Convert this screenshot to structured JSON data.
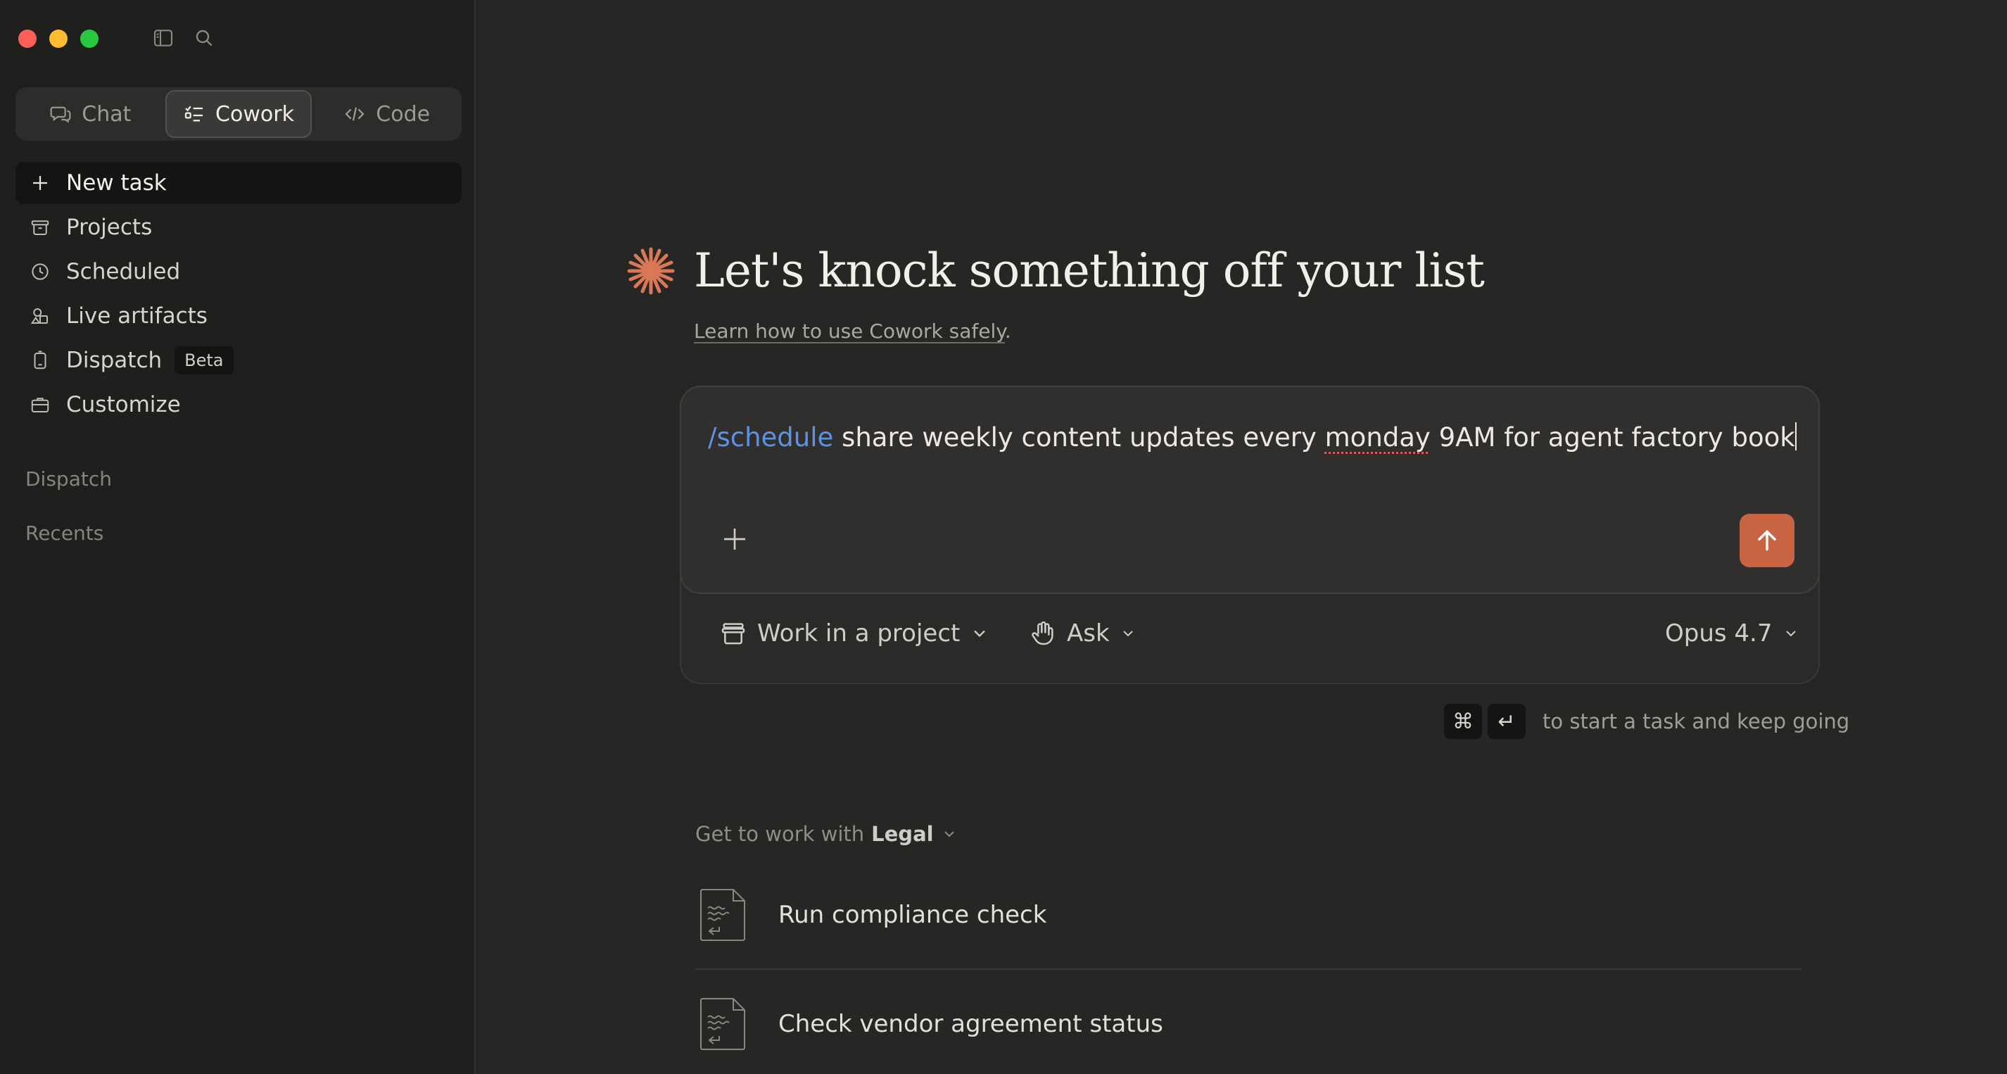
{
  "colors": {
    "accent": "#c96442",
    "command": "#5c93e6",
    "sidebar_bg": "#1f1f1e",
    "main_bg": "#262624"
  },
  "sidebar": {
    "modes": [
      {
        "label": "Chat",
        "icon": "chat-bubbles-icon",
        "active": false
      },
      {
        "label": "Cowork",
        "icon": "checklist-icon",
        "active": true
      },
      {
        "label": "Code",
        "icon": "code-brackets-icon",
        "active": false
      }
    ],
    "nav": [
      {
        "label": "New task",
        "icon": "plus-icon",
        "active": true
      },
      {
        "label": "Projects",
        "icon": "archive-box-icon"
      },
      {
        "label": "Scheduled",
        "icon": "clock-icon"
      },
      {
        "label": "Live artifacts",
        "icon": "shapes-icon"
      },
      {
        "label": "Dispatch",
        "icon": "phone-icon",
        "badge": "Beta"
      },
      {
        "label": "Customize",
        "icon": "briefcase-icon"
      }
    ],
    "sections": {
      "dispatch": "Dispatch",
      "recents": "Recents"
    }
  },
  "main": {
    "title": "Let's knock something off your list",
    "learn_link": "Learn how to use Cowork safely",
    "learn_suffix": ".",
    "composer": {
      "command": "/schedule",
      "text_before": " share weekly content updates every ",
      "misspelled": "monday",
      "text_after": " 9AM for agent factory book"
    },
    "controls": {
      "project": "Work in a project",
      "mode": "Ask",
      "model": "Opus 4.7"
    },
    "shortcut": {
      "key1": "⌘",
      "key2": "↵",
      "hint": "to start a task and keep going"
    },
    "get_to_work": {
      "prefix": "Get to work with",
      "plugin": "Legal"
    },
    "tasks": [
      {
        "label": "Run compliance check"
      },
      {
        "label": "Check vendor agreement status"
      }
    ]
  }
}
